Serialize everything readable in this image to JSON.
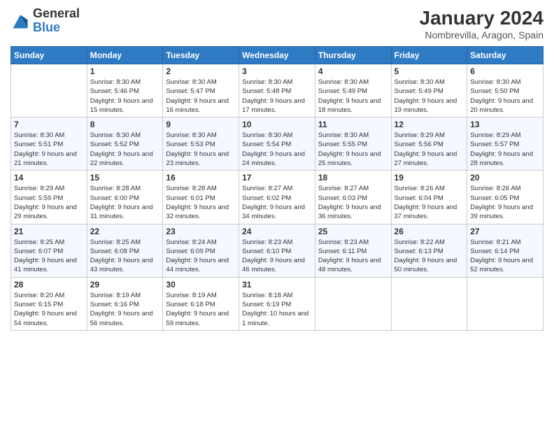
{
  "header": {
    "logo_general": "General",
    "logo_blue": "Blue",
    "title": "January 2024",
    "location": "Nombrevilla, Aragon, Spain"
  },
  "weekdays": [
    "Sunday",
    "Monday",
    "Tuesday",
    "Wednesday",
    "Thursday",
    "Friday",
    "Saturday"
  ],
  "weeks": [
    [
      {
        "day": "",
        "sunrise": "",
        "sunset": "",
        "daylight": ""
      },
      {
        "day": "1",
        "sunrise": "Sunrise: 8:30 AM",
        "sunset": "Sunset: 5:46 PM",
        "daylight": "Daylight: 9 hours and 15 minutes."
      },
      {
        "day": "2",
        "sunrise": "Sunrise: 8:30 AM",
        "sunset": "Sunset: 5:47 PM",
        "daylight": "Daylight: 9 hours and 16 minutes."
      },
      {
        "day": "3",
        "sunrise": "Sunrise: 8:30 AM",
        "sunset": "Sunset: 5:48 PM",
        "daylight": "Daylight: 9 hours and 17 minutes."
      },
      {
        "day": "4",
        "sunrise": "Sunrise: 8:30 AM",
        "sunset": "Sunset: 5:49 PM",
        "daylight": "Daylight: 9 hours and 18 minutes."
      },
      {
        "day": "5",
        "sunrise": "Sunrise: 8:30 AM",
        "sunset": "Sunset: 5:49 PM",
        "daylight": "Daylight: 9 hours and 19 minutes."
      },
      {
        "day": "6",
        "sunrise": "Sunrise: 8:30 AM",
        "sunset": "Sunset: 5:50 PM",
        "daylight": "Daylight: 9 hours and 20 minutes."
      }
    ],
    [
      {
        "day": "7",
        "sunrise": "Sunrise: 8:30 AM",
        "sunset": "Sunset: 5:51 PM",
        "daylight": "Daylight: 9 hours and 21 minutes."
      },
      {
        "day": "8",
        "sunrise": "Sunrise: 8:30 AM",
        "sunset": "Sunset: 5:52 PM",
        "daylight": "Daylight: 9 hours and 22 minutes."
      },
      {
        "day": "9",
        "sunrise": "Sunrise: 8:30 AM",
        "sunset": "Sunset: 5:53 PM",
        "daylight": "Daylight: 9 hours and 23 minutes."
      },
      {
        "day": "10",
        "sunrise": "Sunrise: 8:30 AM",
        "sunset": "Sunset: 5:54 PM",
        "daylight": "Daylight: 9 hours and 24 minutes."
      },
      {
        "day": "11",
        "sunrise": "Sunrise: 8:30 AM",
        "sunset": "Sunset: 5:55 PM",
        "daylight": "Daylight: 9 hours and 25 minutes."
      },
      {
        "day": "12",
        "sunrise": "Sunrise: 8:29 AM",
        "sunset": "Sunset: 5:56 PM",
        "daylight": "Daylight: 9 hours and 27 minutes."
      },
      {
        "day": "13",
        "sunrise": "Sunrise: 8:29 AM",
        "sunset": "Sunset: 5:57 PM",
        "daylight": "Daylight: 9 hours and 28 minutes."
      }
    ],
    [
      {
        "day": "14",
        "sunrise": "Sunrise: 8:29 AM",
        "sunset": "Sunset: 5:59 PM",
        "daylight": "Daylight: 9 hours and 29 minutes."
      },
      {
        "day": "15",
        "sunrise": "Sunrise: 8:28 AM",
        "sunset": "Sunset: 6:00 PM",
        "daylight": "Daylight: 9 hours and 31 minutes."
      },
      {
        "day": "16",
        "sunrise": "Sunrise: 8:28 AM",
        "sunset": "Sunset: 6:01 PM",
        "daylight": "Daylight: 9 hours and 32 minutes."
      },
      {
        "day": "17",
        "sunrise": "Sunrise: 8:27 AM",
        "sunset": "Sunset: 6:02 PM",
        "daylight": "Daylight: 9 hours and 34 minutes."
      },
      {
        "day": "18",
        "sunrise": "Sunrise: 8:27 AM",
        "sunset": "Sunset: 6:03 PM",
        "daylight": "Daylight: 9 hours and 36 minutes."
      },
      {
        "day": "19",
        "sunrise": "Sunrise: 8:26 AM",
        "sunset": "Sunset: 6:04 PM",
        "daylight": "Daylight: 9 hours and 37 minutes."
      },
      {
        "day": "20",
        "sunrise": "Sunrise: 8:26 AM",
        "sunset": "Sunset: 6:05 PM",
        "daylight": "Daylight: 9 hours and 39 minutes."
      }
    ],
    [
      {
        "day": "21",
        "sunrise": "Sunrise: 8:25 AM",
        "sunset": "Sunset: 6:07 PM",
        "daylight": "Daylight: 9 hours and 41 minutes."
      },
      {
        "day": "22",
        "sunrise": "Sunrise: 8:25 AM",
        "sunset": "Sunset: 6:08 PM",
        "daylight": "Daylight: 9 hours and 43 minutes."
      },
      {
        "day": "23",
        "sunrise": "Sunrise: 8:24 AM",
        "sunset": "Sunset: 6:09 PM",
        "daylight": "Daylight: 9 hours and 44 minutes."
      },
      {
        "day": "24",
        "sunrise": "Sunrise: 8:23 AM",
        "sunset": "Sunset: 6:10 PM",
        "daylight": "Daylight: 9 hours and 46 minutes."
      },
      {
        "day": "25",
        "sunrise": "Sunrise: 8:23 AM",
        "sunset": "Sunset: 6:11 PM",
        "daylight": "Daylight: 9 hours and 48 minutes."
      },
      {
        "day": "26",
        "sunrise": "Sunrise: 8:22 AM",
        "sunset": "Sunset: 6:13 PM",
        "daylight": "Daylight: 9 hours and 50 minutes."
      },
      {
        "day": "27",
        "sunrise": "Sunrise: 8:21 AM",
        "sunset": "Sunset: 6:14 PM",
        "daylight": "Daylight: 9 hours and 52 minutes."
      }
    ],
    [
      {
        "day": "28",
        "sunrise": "Sunrise: 8:20 AM",
        "sunset": "Sunset: 6:15 PM",
        "daylight": "Daylight: 9 hours and 54 minutes."
      },
      {
        "day": "29",
        "sunrise": "Sunrise: 8:19 AM",
        "sunset": "Sunset: 6:16 PM",
        "daylight": "Daylight: 9 hours and 56 minutes."
      },
      {
        "day": "30",
        "sunrise": "Sunrise: 8:19 AM",
        "sunset": "Sunset: 6:18 PM",
        "daylight": "Daylight: 9 hours and 59 minutes."
      },
      {
        "day": "31",
        "sunrise": "Sunrise: 8:18 AM",
        "sunset": "Sunset: 6:19 PM",
        "daylight": "Daylight: 10 hours and 1 minute."
      },
      {
        "day": "",
        "sunrise": "",
        "sunset": "",
        "daylight": ""
      },
      {
        "day": "",
        "sunrise": "",
        "sunset": "",
        "daylight": ""
      },
      {
        "day": "",
        "sunrise": "",
        "sunset": "",
        "daylight": ""
      }
    ]
  ]
}
